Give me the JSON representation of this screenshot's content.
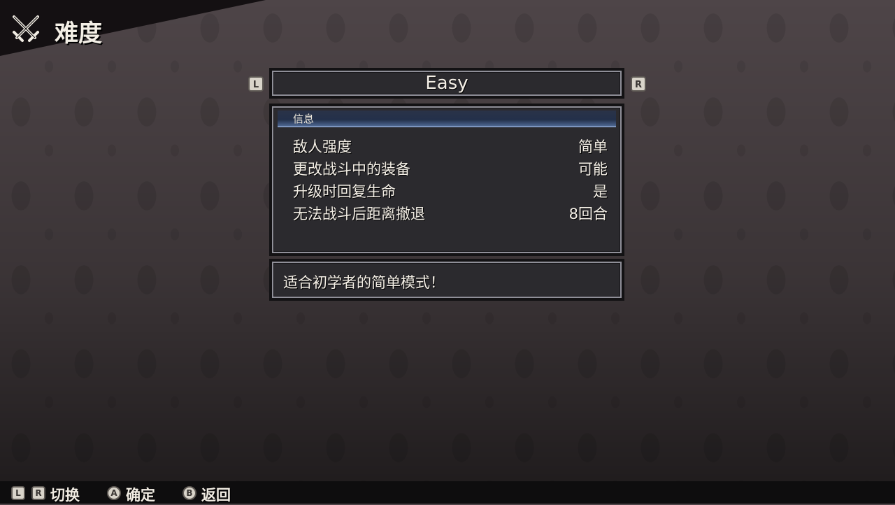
{
  "header": {
    "title": "难度",
    "icon": "crossed-swords-icon"
  },
  "selector": {
    "left_button": "L",
    "value": "Easy",
    "right_button": "R"
  },
  "info": {
    "header": "信息",
    "rows": [
      {
        "label": "敌人强度",
        "value": "简单"
      },
      {
        "label": "更改战斗中的装备",
        "value": "可能"
      },
      {
        "label": "升级时回复生命",
        "value": "是"
      },
      {
        "label": "无法战斗后距离撤退",
        "value": "8回合"
      }
    ]
  },
  "description": "适合初学者的简单模式！",
  "footer": {
    "switch": {
      "buttons": [
        "L",
        "R"
      ],
      "label": "切换"
    },
    "confirm": {
      "button": "A",
      "label": "确定"
    },
    "back": {
      "button": "B",
      "label": "返回"
    }
  }
}
